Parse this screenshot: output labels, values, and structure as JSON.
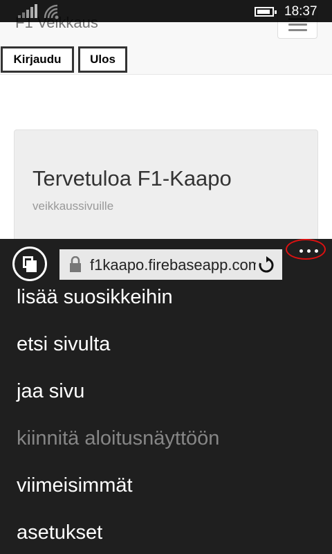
{
  "status_bar": {
    "time": "18:37"
  },
  "page": {
    "brand": "F1 Veikkaus",
    "login_button": "Kirjaudu",
    "logout_button": "Ulos",
    "hero_title": "Tervetuloa F1-Kaapo",
    "hero_subtitle": "veikkaussivuille"
  },
  "browser": {
    "url": "f1kaapo.firebaseapp.com",
    "menu_items": [
      {
        "label": "lisää suosikkeihin",
        "enabled": true
      },
      {
        "label": "etsi sivulta",
        "enabled": true
      },
      {
        "label": "jaa sivu",
        "enabled": true
      },
      {
        "label": "kiinnitä aloitusnäyttöön",
        "enabled": false
      },
      {
        "label": "viimeisimmät",
        "enabled": true
      },
      {
        "label": "asetukset",
        "enabled": true
      }
    ]
  },
  "colors": {
    "menu_background": "#1f1f1f",
    "disabled_text": "#868686",
    "highlight_circle": "#dd1111"
  }
}
